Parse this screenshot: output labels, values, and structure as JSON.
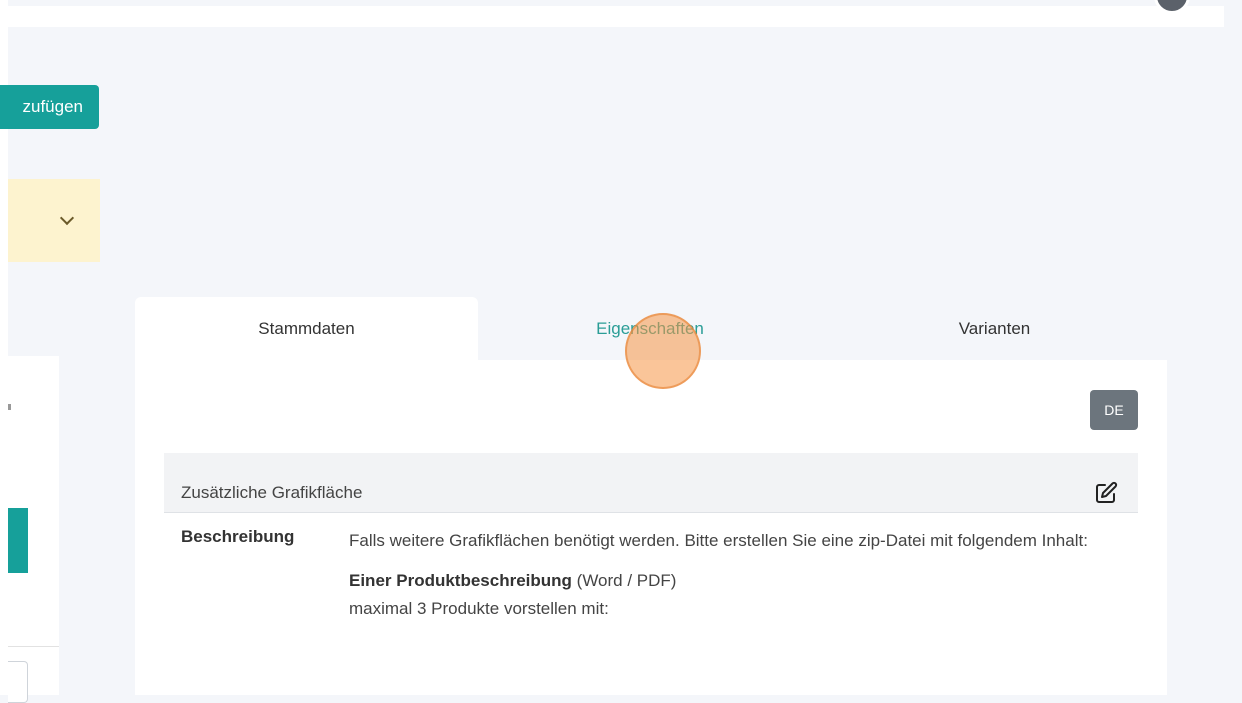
{
  "toolbar": {
    "add_label": "zufügen"
  },
  "tabs": [
    {
      "label": "Stammdaten",
      "state": "active"
    },
    {
      "label": "Eigenschaften",
      "state": "hover"
    },
    {
      "label": "Varianten",
      "state": "normal"
    }
  ],
  "language": "DE",
  "section": {
    "title": "Zusätzliche Grafikfläche",
    "description_label": "Beschreibung",
    "description_intro": "Falls weitere Grafikflächen benötigt werden. Bitte erstellen Sie eine zip-Datei mit folgendem Inhalt:",
    "product_desc_bold": "Einer Produktbeschreibung",
    "product_desc_rest": " (Word / PDF)",
    "max_products": "maximal 3 Produkte vorstellen mit:"
  },
  "icons": {
    "chevron": "chevron-down-icon",
    "edit": "edit-icon"
  },
  "colors": {
    "accent": "#16a09a",
    "badge": "#6c757d",
    "warning_bg": "#fdf3cf"
  }
}
